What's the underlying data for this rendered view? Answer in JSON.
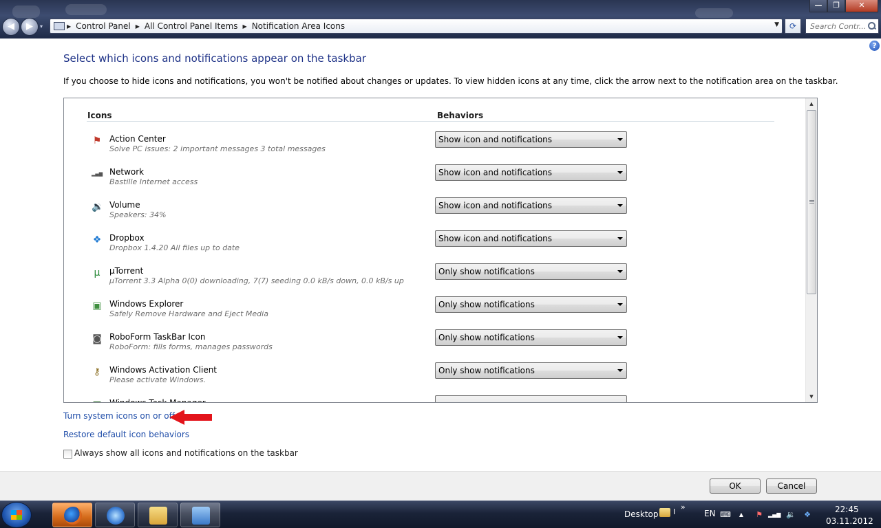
{
  "window": {
    "controls": {
      "minimize": "—",
      "maximize": "❐",
      "close": "✕"
    },
    "nav": {
      "back": "◀",
      "forward": "▶",
      "dropdown": "▾"
    }
  },
  "breadcrumb": {
    "items": [
      "Control Panel",
      "All Control Panel Items",
      "Notification Area Icons"
    ],
    "separator": "▶",
    "dropdown": "▼"
  },
  "refresh": "⟳",
  "search": {
    "placeholder": "Search Contr..."
  },
  "help": "?",
  "main": {
    "title": "Select which icons and notifications appear on the taskbar",
    "description": "If you choose to hide icons and notifications, you won't be notified about changes or updates. To view hidden icons at any time, click the arrow next to the notification area on the taskbar.",
    "columns": {
      "icons": "Icons",
      "behaviors": "Behaviors"
    },
    "rows": [
      {
        "name": "Action Center",
        "desc": "Solve PC issues: 2 important messages  3 total messages",
        "behavior": "Show icon and notifications",
        "icon": "action-center-flag-icon",
        "glyph": "⚑",
        "color": "#c0392b"
      },
      {
        "name": "Network",
        "desc": "Bastille Internet access",
        "behavior": "Show icon and notifications",
        "icon": "network-signal-icon",
        "glyph": "▂▄▆",
        "color": "#555555"
      },
      {
        "name": "Volume",
        "desc": "Speakers: 34%",
        "behavior": "Show icon and notifications",
        "icon": "speaker-icon",
        "glyph": "🔉",
        "color": "#555555"
      },
      {
        "name": "Dropbox",
        "desc": "Dropbox 1.4.20 All files up to date",
        "behavior": "Show icon and notifications",
        "icon": "dropbox-icon",
        "glyph": "❖",
        "color": "#1f7ad3"
      },
      {
        "name": "µTorrent",
        "desc": "µTorrent 3.3 Alpha  0(0) downloading, 7(7) seeding  0.0 kB/s down, 0.0 kB/s up",
        "behavior": "Only show notifications",
        "icon": "utorrent-icon",
        "glyph": "µ",
        "color": "#2a8a3a"
      },
      {
        "name": "Windows Explorer",
        "desc": "Safely Remove Hardware and Eject Media",
        "behavior": "Only show notifications",
        "icon": "usb-device-icon",
        "glyph": "▣",
        "color": "#3f8f3f"
      },
      {
        "name": "RoboForm TaskBar Icon",
        "desc": "RoboForm: fills forms, manages passwords",
        "behavior": "Only show notifications",
        "icon": "roboform-icon",
        "glyph": "◙",
        "color": "#555555"
      },
      {
        "name": "Windows Activation Client",
        "desc": "Please activate Windows.",
        "behavior": "Only show notifications",
        "icon": "keys-icon",
        "glyph": "⚷",
        "color": "#8a6d1f"
      },
      {
        "name": "Windows Task Manager",
        "desc": "",
        "behavior": "",
        "icon": "task-manager-icon",
        "glyph": "■",
        "color": "#2a6a2a"
      }
    ]
  },
  "scrollbar": {
    "up": "▲",
    "down": "▼"
  },
  "links": {
    "system_icons": "Turn system icons on or off",
    "restore": "Restore default icon behaviors"
  },
  "always_show": {
    "label": "Always show all icons and notifications on the taskbar",
    "checked": false
  },
  "buttons": {
    "ok": "OK",
    "cancel": "Cancel"
  },
  "taskbar": {
    "desktop": "Desktop",
    "desktop_bar": "I",
    "more": "»",
    "language": "EN",
    "tray": {
      "keyboard": "⌨",
      "show_hidden": "▲",
      "flag": "⚑",
      "network": "▂▄▆",
      "volume": "🔉",
      "dropbox": "❖"
    },
    "time": "22:45",
    "date": "03.11.2012"
  },
  "colors": {
    "accent": "#1e3287",
    "link": "#1e4ca8",
    "arrow": "#e3141b"
  }
}
